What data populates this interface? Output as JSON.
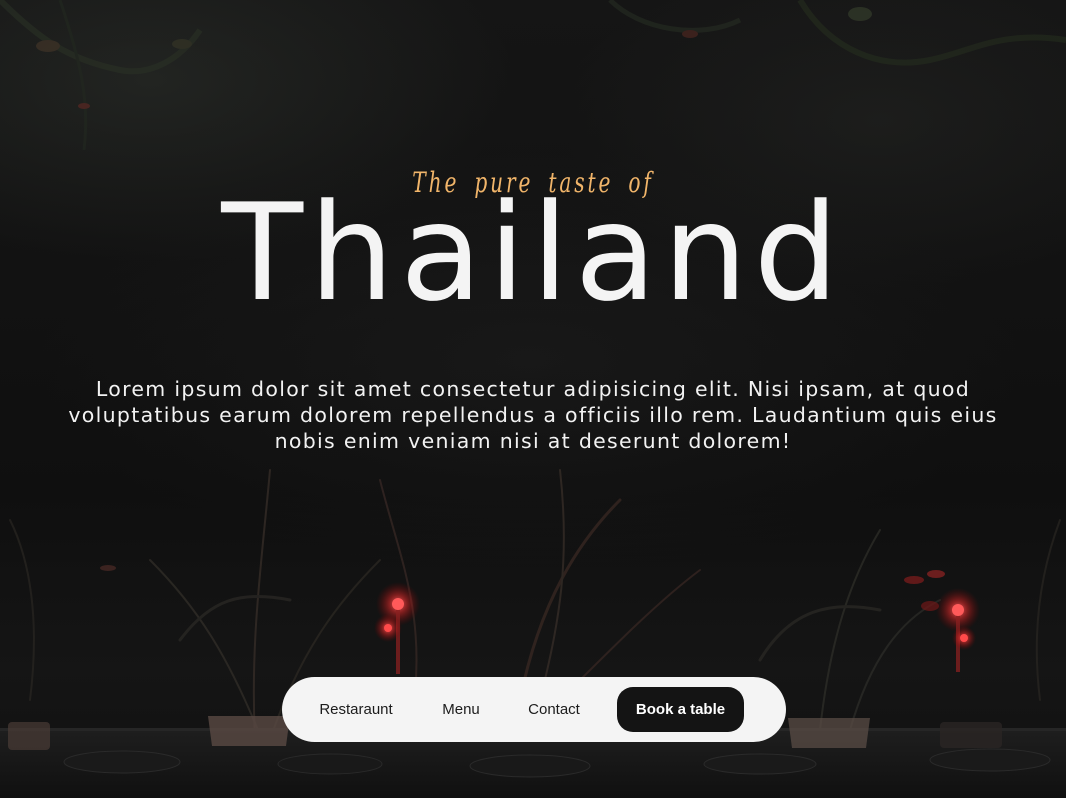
{
  "hero": {
    "tagline": "The pure taste of",
    "title": "Thailand",
    "description": "Lorem ipsum dolor sit amet consectetur adipisicing elit. Nisi ipsam, at quod voluptatibus earum dolorem repellendus a officiis illo rem. Laudantium quis eius nobis enim veniam nisi at deserunt dolorem!"
  },
  "nav": {
    "restaurant_label": "Restaraunt",
    "menu_label": "Menu",
    "contact_label": "Contact",
    "book_label": "Book a table"
  },
  "colors": {
    "tagline": "#f1b56a",
    "title": "#f4f4f4",
    "navbar_background": "#f4f4f4",
    "button_background": "#141414",
    "candle_glow": "#ff4a4a"
  }
}
